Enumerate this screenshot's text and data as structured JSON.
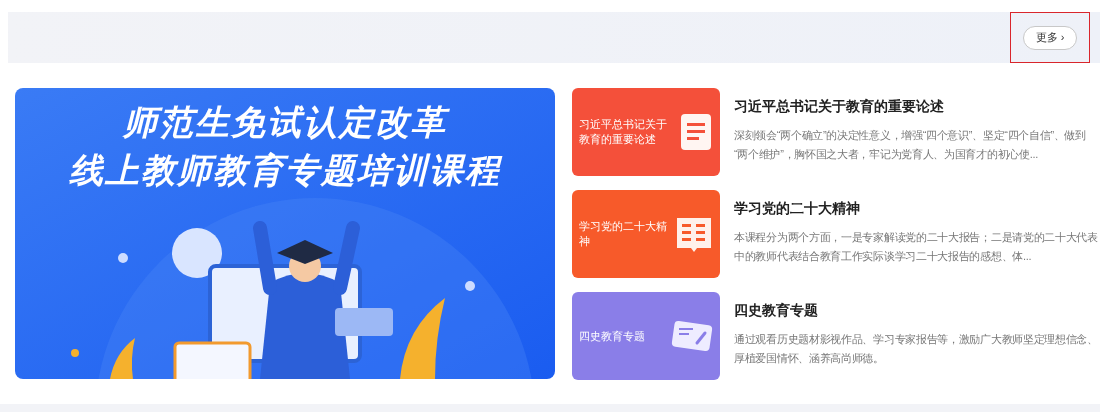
{
  "header": {
    "more_button": "更多 ›",
    "highlighted": true
  },
  "banner": {
    "kind": "picture",
    "title_lines": [
      "师范生免试认定改革",
      "线上教师教育专题培训课程"
    ]
  },
  "courses": [
    {
      "thumb_label": "习近平总书记关于教育的重要论述",
      "color": "#f4503a",
      "kind": "document",
      "title": "习近平总书记关于教育的重要论述",
      "description": "深刻领会“两个确立”的决定性意义，增强“四个意识”、坚定“四个自信”、做到 “两个维护”，胸怀国之大者，牢记为党育人、为国育才的初心使..."
    },
    {
      "thumb_label": "学习党的二十大精神",
      "color": "#f75a2a",
      "kind": "book",
      "title": "学习党的二十大精神",
      "description": "本课程分为两个方面，一是专家解读党的二十大报告；二是请党的二十大代表中的教师代表结合教育工作实际谈学习二十大报告的感想、体..."
    },
    {
      "thumb_label": "四史教育专题",
      "color": "#8a7ee8",
      "kind": "card",
      "title": "四史教育专题",
      "description": "通过观看历史题材影视作品、学习专家报告等，激励广大教师坚定理想信念、厚植爱国情怀、涵养高尚师德。"
    }
  ]
}
